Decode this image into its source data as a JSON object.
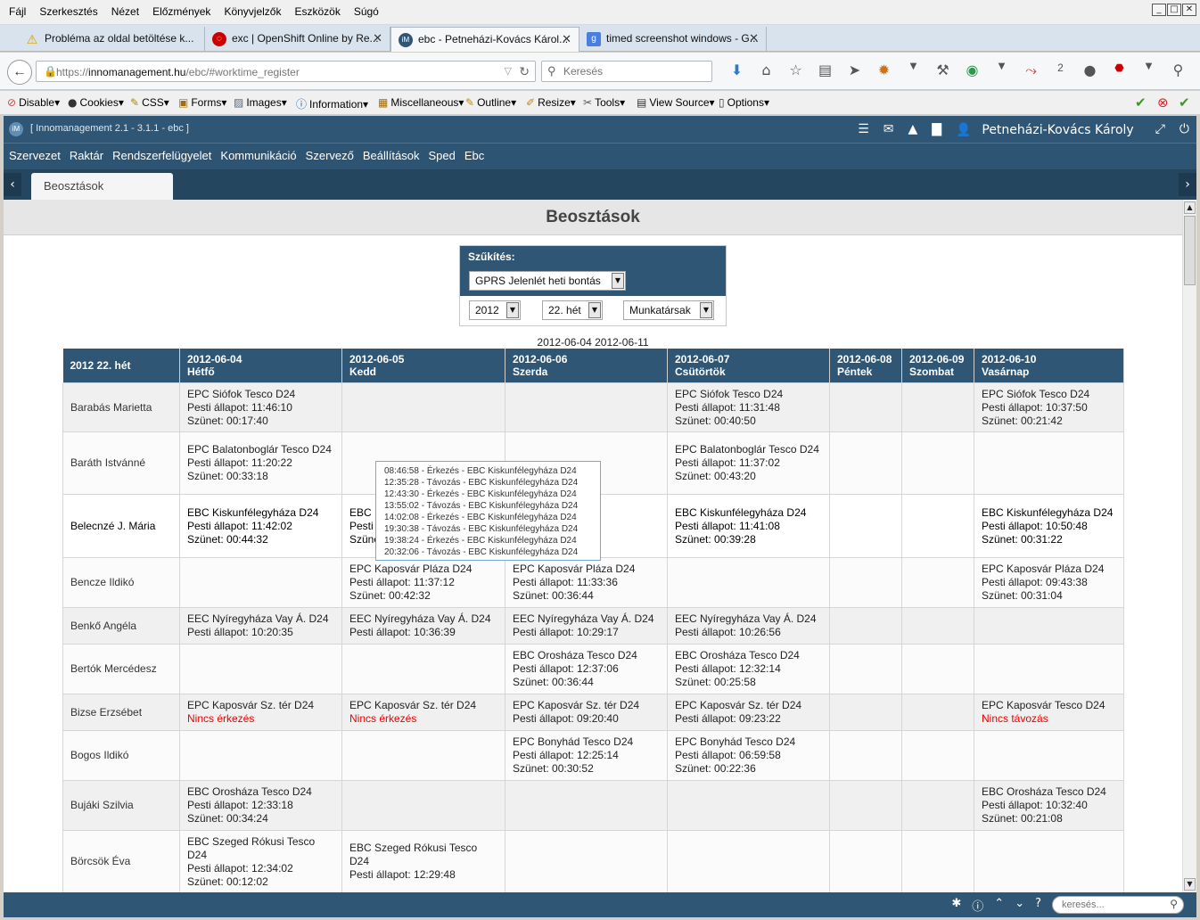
{
  "browser": {
    "menu": [
      "Fájl",
      "Szerkesztés",
      "Nézet",
      "Előzmények",
      "Könyvjelzők",
      "Eszközök",
      "Súgó"
    ],
    "tabs": [
      {
        "title": "Probléma az oldal betöltése k...",
        "icon": "warning-icon"
      },
      {
        "title": "exc | OpenShift Online by Re...",
        "icon": "openshift-icon"
      },
      {
        "title": "ebc - Petneházi-Kovács Károl...",
        "icon": "app-icon"
      },
      {
        "title": "timed screenshot windows - G...",
        "icon": "google-icon"
      }
    ],
    "url_prefix": "https://",
    "url_host": "innomanagement.hu",
    "url_path": "/ebc/#worktime_register",
    "search_placeholder": "Keresés",
    "download_badge": "2",
    "devtools": [
      "Disable",
      "Cookies",
      "CSS",
      "Forms",
      "Images",
      "Information",
      "Miscellaneous",
      "Outline",
      "Resize",
      "Tools",
      "View Source",
      "Options"
    ]
  },
  "app": {
    "title": "[ Innomanagement 2.1 - 3.1.1 - ebc ]",
    "user": "Petneházi-Kovács Károly",
    "nav": [
      "Szervezet",
      "Raktár",
      "Rendszerfelügyelet",
      "Kommunikáció",
      "Szervező",
      "Beállítások",
      "Sped",
      "Ebc"
    ],
    "open_tab": "Beosztások",
    "page_title": "Beosztások",
    "footer_search_placeholder": "keresés..."
  },
  "filter": {
    "label": "Szűkítés:",
    "report": "GPRS Jelenlét heti bontás",
    "year": "2012",
    "week": "22. hét",
    "group": "Munkatársak"
  },
  "range": "2012-06-04 2012-06-11",
  "table": {
    "corner": "2012 22. hét",
    "days": [
      {
        "date": "2012-06-04",
        "name": "Hétfő"
      },
      {
        "date": "2012-06-05",
        "name": "Kedd"
      },
      {
        "date": "2012-06-06",
        "name": "Szerda"
      },
      {
        "date": "2012-06-07",
        "name": "Csütörtök"
      },
      {
        "date": "2012-06-08",
        "name": "Péntek"
      },
      {
        "date": "2012-06-09",
        "name": "Szombat"
      },
      {
        "date": "2012-06-10",
        "name": "Vasárnap"
      }
    ],
    "rows": [
      {
        "name": "Barabás Marietta",
        "cells": [
          [
            "EPC Siófok Tesco D24",
            "Pesti állapot: 11:46:10",
            "Szünet: 00:17:40"
          ],
          [],
          [],
          [
            "EPC Siófok Tesco D24",
            "Pesti állapot: 11:31:48",
            "Szünet: 00:40:50"
          ],
          [],
          [],
          [
            "EPC Siófok Tesco D24",
            "Pesti állapot: 10:37:50",
            "Szünet: 00:21:42"
          ]
        ]
      },
      {
        "name": "Baráth Istvánné",
        "cells": [
          [
            "EPC Balatonboglár Tesco D24",
            "Pesti állapot: 11:20:22",
            "Szünet: 00:33:18"
          ],
          [],
          [],
          [
            "EPC Balatonboglár Tesco D24",
            "Pesti állapot: 11:37:02",
            "Szünet: 00:43:20"
          ],
          [],
          [],
          []
        ]
      },
      {
        "name": "Belecnzé J. Mária",
        "highlight": true,
        "cells": [
          [
            "EBC Kiskunfélegyháza D24",
            "Pesti állapot: 11:42:02",
            "Szünet: 00:44:32"
          ],
          [
            "EBC",
            "Pesti",
            "Szünet"
          ],
          [],
          [
            "EBC Kiskunfélegyháza D24",
            "Pesti állapot: 11:41:08",
            "Szünet: 00:39:28"
          ],
          [],
          [],
          [
            "EBC Kiskunfélegyháza D24",
            "Pesti állapot: 10:50:48",
            "Szünet: 00:31:22"
          ]
        ]
      },
      {
        "name": "Bencze Ildikó",
        "cells": [
          [],
          [
            "EPC Kaposvár Pláza D24",
            "Pesti állapot: 11:37:12",
            "Szünet: 00:42:32"
          ],
          [
            "EPC Kaposvár Pláza D24",
            "Pesti állapot: 11:33:36",
            "Szünet: 00:36:44"
          ],
          [],
          [],
          [],
          [
            "EPC Kaposvár Pláza D24",
            "Pesti állapot: 09:43:38",
            "Szünet: 00:31:04"
          ]
        ]
      },
      {
        "name": "Benkő Angéla",
        "cells": [
          [
            "EEC Nyíregyháza Vay Á. D24",
            "Pesti állapot: 10:20:35"
          ],
          [
            "EEC Nyíregyháza Vay Á. D24",
            "Pesti állapot: 10:36:39"
          ],
          [
            "EEC Nyíregyháza Vay Á. D24",
            "Pesti állapot: 10:29:17"
          ],
          [
            "EEC Nyíregyháza Vay Á. D24",
            "Pesti állapot: 10:26:56"
          ],
          [],
          [],
          []
        ]
      },
      {
        "name": "Bertók Mercédesz",
        "cells": [
          [],
          [],
          [
            "EBC Orosháza Tesco D24",
            "Pesti állapot: 12:37:06",
            "Szünet: 00:36:44"
          ],
          [
            "EBC Orosháza Tesco D24",
            "Pesti állapot: 12:32:14",
            "Szünet: 00:25:58"
          ],
          [],
          [],
          []
        ]
      },
      {
        "name": "Bizse Erzsébet",
        "cells": [
          [
            "EPC Kaposvár Sz. tér D24",
            "!Nincs érkezés"
          ],
          [
            "EPC Kaposvár Sz. tér D24",
            "!Nincs érkezés"
          ],
          [
            "EPC Kaposvár Sz. tér D24",
            "Pesti állapot: 09:20:40"
          ],
          [
            "EPC Kaposvár Sz. tér D24",
            "Pesti állapot: 09:23:22"
          ],
          [],
          [],
          [
            "EPC Kaposvár Tesco D24",
            "!Nincs távozás"
          ]
        ]
      },
      {
        "name": "Bogos Ildikó",
        "cells": [
          [],
          [],
          [
            "EPC Bonyhád Tesco D24",
            "Pesti állapot: 12:25:14",
            "Szünet: 00:30:52"
          ],
          [
            "EPC Bonyhád Tesco D24",
            "Pesti állapot: 06:59:58",
            "Szünet: 00:22:36"
          ],
          [],
          [],
          []
        ]
      },
      {
        "name": "Bujáki Szilvia",
        "cells": [
          [
            "EBC Orosháza Tesco D24",
            "Pesti állapot: 12:33:18",
            "Szünet: 00:34:24"
          ],
          [],
          [],
          [],
          [],
          [],
          [
            "EBC Orosháza Tesco D24",
            "Pesti állapot: 10:32:40",
            "Szünet: 00:21:08"
          ]
        ]
      },
      {
        "name": "Börcsök Éva",
        "cells": [
          [
            "EBC Szeged Rókusi Tesco D24",
            "Pesti állapot: 12:34:02",
            "Szünet: 00:12:02"
          ],
          [
            "EBC Szeged Rókusi Tesco D24",
            "Pesti állapot: 12:29:48"
          ],
          [],
          [],
          [],
          [],
          []
        ]
      }
    ]
  },
  "tooltip": [
    "08:46:58 - Érkezés - EBC Kiskunfélegyháza D24",
    "12:35:28 - Távozás - EBC Kiskunfélegyháza D24",
    "12:43:30 - Érkezés - EBC Kiskunfélegyháza D24",
    "13:55:02 - Távozás - EBC Kiskunfélegyháza D24",
    "14:02:08 - Érkezés - EBC Kiskunfélegyháza D24",
    "19:30:38 - Távozás - EBC Kiskunfélegyháza D24",
    "19:38:24 - Érkezés - EBC Kiskunfélegyháza D24",
    "20:32:06 - Távozás - EBC Kiskunfélegyháza D24"
  ]
}
